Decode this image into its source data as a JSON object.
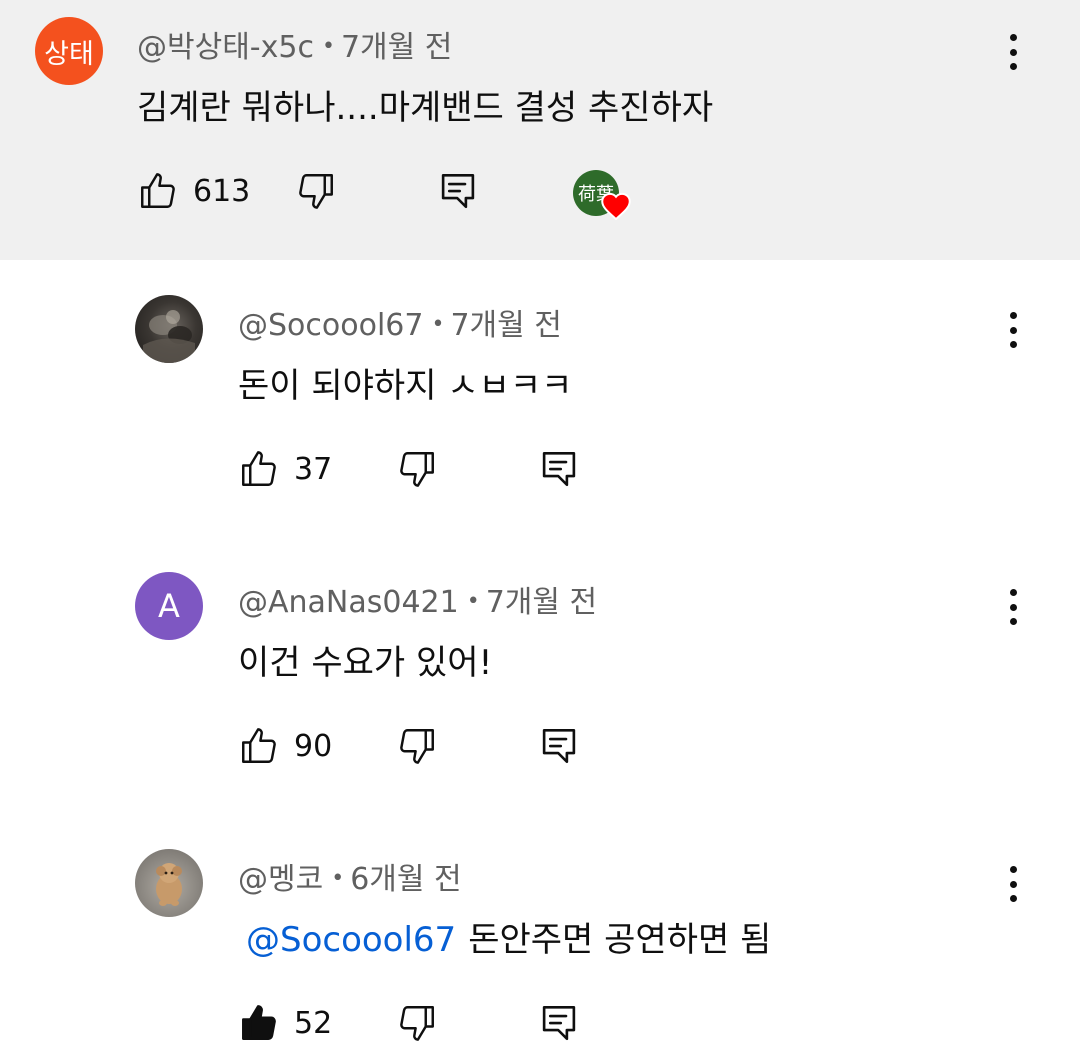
{
  "comments": [
    {
      "avatar_text": "상태",
      "avatar_color": "#f4511e",
      "handle": "@박상태-x5c",
      "separator": "•",
      "time": "7개월 전",
      "text": "김계란 뭐하나....마계밴드 결성 추진하자",
      "likes": "613",
      "liked": false,
      "hearted": true,
      "creator_avatar_text": "荷葉"
    },
    {
      "avatar_type": "photo",
      "handle": "@Socoool67",
      "separator": "•",
      "time": "7개월 전",
      "text": "돈이 되야하지 ㅅㅂㅋㅋ",
      "likes": "37",
      "liked": false
    },
    {
      "avatar_text": "A",
      "avatar_color": "#7e57c2",
      "handle": "@AnaNas0421",
      "separator": "•",
      "time": "7개월 전",
      "text": "이건 수요가 있어!",
      "likes": "90",
      "liked": false
    },
    {
      "avatar_type": "dog-photo",
      "handle": "@멩코",
      "separator": "•",
      "time": "6개월 전",
      "mention": "@Socoool67",
      "text": "돈안주면 공연하면 됨",
      "likes": "52",
      "liked": true
    }
  ],
  "colors": {
    "highlight_background": "#f0f0f0",
    "meta_text": "#606060",
    "mention_link": "#065fd4",
    "heart": "#ff0000"
  },
  "icons": [
    "like-icon",
    "dislike-icon",
    "reply-icon",
    "more-options-icon",
    "heart-icon"
  ]
}
